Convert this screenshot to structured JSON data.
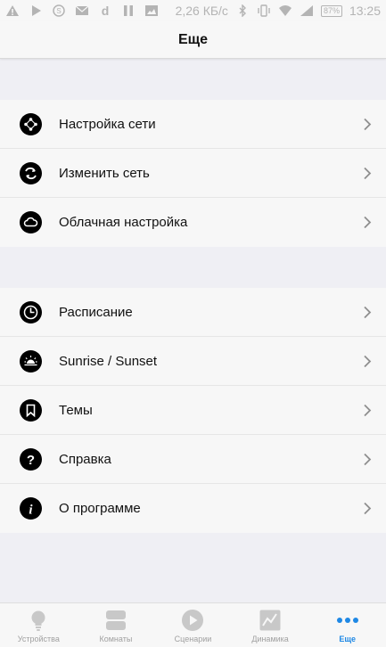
{
  "status_bar": {
    "network_speed": "2,26 КБ/с",
    "battery": "87%",
    "time": "13:25",
    "icons": [
      "warning-icon",
      "play-icon",
      "skype-icon",
      "mail-icon",
      "d-app-icon",
      "pause-icon",
      "image-icon",
      "bluetooth-icon",
      "vibrate-icon",
      "wifi-icon",
      "signal-icon",
      "battery-icon"
    ]
  },
  "header": {
    "title": "Еще"
  },
  "groups": [
    {
      "items": [
        {
          "label": "Настройка сети",
          "icon": "network-icon"
        },
        {
          "label": "Изменить сеть",
          "icon": "switch-network-icon"
        },
        {
          "label": "Облачная настройка",
          "icon": "cloud-icon"
        }
      ]
    },
    {
      "items": [
        {
          "label": "Расписание",
          "icon": "clock-icon"
        },
        {
          "label": "Sunrise / Sunset",
          "icon": "sunrise-icon"
        },
        {
          "label": "Темы",
          "icon": "bookmark-icon"
        },
        {
          "label": "Справка",
          "icon": "help-icon"
        },
        {
          "label": "О программе",
          "icon": "info-icon"
        }
      ]
    }
  ],
  "tabbar": {
    "active": "Еще",
    "tabs": [
      {
        "label": "Устройства",
        "icon": "bulb-icon"
      },
      {
        "label": "Комнаты",
        "icon": "rooms-icon"
      },
      {
        "label": "Сценарии",
        "icon": "play-circle-icon"
      },
      {
        "label": "Динамика",
        "icon": "chart-icon"
      },
      {
        "label": "Еще",
        "icon": "more-icon"
      }
    ]
  },
  "colors": {
    "accent": "#1e88e5",
    "inactive": "#a0a0a0",
    "icon_bg": "#000000",
    "background": "#efeff4"
  }
}
